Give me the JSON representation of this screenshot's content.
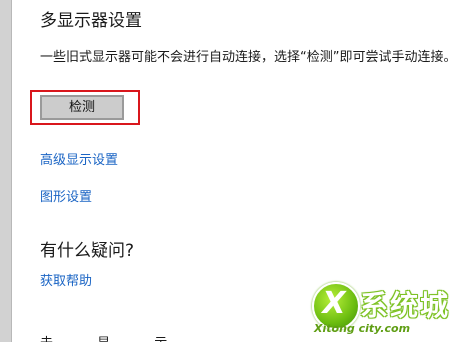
{
  "section": {
    "title": "多显示器设置",
    "description": "一些旧式显示器可能不会进行自动连接，选择“检测”即可尝试手动连接。",
    "detect_label": "检测"
  },
  "links": {
    "advanced_display": "高级显示设置",
    "graphics_settings": "图形设置"
  },
  "question": {
    "title": "有什么疑问?",
    "help_link": "获取帮助"
  },
  "cut_off_text": "未 显 示",
  "watermark": {
    "logo_letter": "X",
    "text": "系统城",
    "url": "Xitong city.com"
  },
  "colors": {
    "link": "#1a64c4",
    "highlight": "#d9161c",
    "button_bg": "#cccccc"
  }
}
